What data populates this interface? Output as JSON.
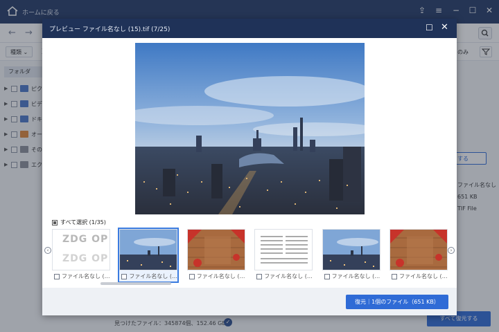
{
  "app": {
    "home_label": "ホームに戻る",
    "filter": {
      "type_label": "種類",
      "second_label": "更",
      "right_label": "のみ"
    },
    "tree_header": "フォルダ",
    "tree": [
      {
        "label": "ピクチ",
        "color": "#4a77c9"
      },
      {
        "label": "ビデオ",
        "color": "#4a77c9"
      },
      {
        "label": "ドキュ",
        "color": "#4a77c9"
      },
      {
        "label": "オーデ",
        "color": "#e0873a"
      },
      {
        "label": "その他",
        "color": "#8c8f99"
      },
      {
        "label": "エクス",
        "color": "#8c8f99"
      }
    ],
    "right_button": "する",
    "right_info": [
      "ファイル名なし（…",
      "651 KB",
      "TIF File"
    ],
    "found_text": "見つけたファイル：345874個、152.46 GB",
    "restore_all": "すべて復元する"
  },
  "modal": {
    "title": "プレビュー ファイル名なし (15).tif (7/25)",
    "select_all": "すべて選択 (1/35)",
    "thumbnails": [
      {
        "kind": "text",
        "caption": "ファイル名なし (…",
        "selected": false
      },
      {
        "kind": "city",
        "caption": "ファイル名なし (…",
        "selected": true
      },
      {
        "kind": "wood",
        "caption": "ファイル名なし (…",
        "selected": false
      },
      {
        "kind": "doc",
        "caption": "ファイル名なし (…",
        "selected": false
      },
      {
        "kind": "city",
        "caption": "ファイル名なし (…",
        "selected": false
      },
      {
        "kind": "wood",
        "caption": "ファイル名なし (…",
        "selected": false
      }
    ],
    "thumb_text": [
      "ZDG OP",
      "ZDG OP"
    ],
    "restore_button": "復元｜1個のファイル（651 KB）"
  },
  "colors": {
    "accent": "#2f6bd6",
    "title_bar": "#1f3258",
    "app_bar": "#233a66"
  }
}
